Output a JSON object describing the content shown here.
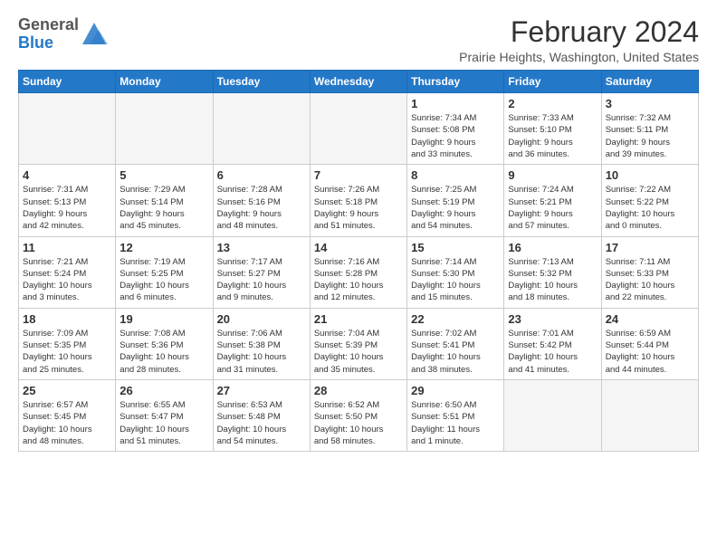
{
  "logo": {
    "general": "General",
    "blue": "Blue"
  },
  "header": {
    "month": "February 2024",
    "location": "Prairie Heights, Washington, United States"
  },
  "weekdays": [
    "Sunday",
    "Monday",
    "Tuesday",
    "Wednesday",
    "Thursday",
    "Friday",
    "Saturday"
  ],
  "weeks": [
    [
      {
        "day": "",
        "info": ""
      },
      {
        "day": "",
        "info": ""
      },
      {
        "day": "",
        "info": ""
      },
      {
        "day": "",
        "info": ""
      },
      {
        "day": "1",
        "info": "Sunrise: 7:34 AM\nSunset: 5:08 PM\nDaylight: 9 hours\nand 33 minutes."
      },
      {
        "day": "2",
        "info": "Sunrise: 7:33 AM\nSunset: 5:10 PM\nDaylight: 9 hours\nand 36 minutes."
      },
      {
        "day": "3",
        "info": "Sunrise: 7:32 AM\nSunset: 5:11 PM\nDaylight: 9 hours\nand 39 minutes."
      }
    ],
    [
      {
        "day": "4",
        "info": "Sunrise: 7:31 AM\nSunset: 5:13 PM\nDaylight: 9 hours\nand 42 minutes."
      },
      {
        "day": "5",
        "info": "Sunrise: 7:29 AM\nSunset: 5:14 PM\nDaylight: 9 hours\nand 45 minutes."
      },
      {
        "day": "6",
        "info": "Sunrise: 7:28 AM\nSunset: 5:16 PM\nDaylight: 9 hours\nand 48 minutes."
      },
      {
        "day": "7",
        "info": "Sunrise: 7:26 AM\nSunset: 5:18 PM\nDaylight: 9 hours\nand 51 minutes."
      },
      {
        "day": "8",
        "info": "Sunrise: 7:25 AM\nSunset: 5:19 PM\nDaylight: 9 hours\nand 54 minutes."
      },
      {
        "day": "9",
        "info": "Sunrise: 7:24 AM\nSunset: 5:21 PM\nDaylight: 9 hours\nand 57 minutes."
      },
      {
        "day": "10",
        "info": "Sunrise: 7:22 AM\nSunset: 5:22 PM\nDaylight: 10 hours\nand 0 minutes."
      }
    ],
    [
      {
        "day": "11",
        "info": "Sunrise: 7:21 AM\nSunset: 5:24 PM\nDaylight: 10 hours\nand 3 minutes."
      },
      {
        "day": "12",
        "info": "Sunrise: 7:19 AM\nSunset: 5:25 PM\nDaylight: 10 hours\nand 6 minutes."
      },
      {
        "day": "13",
        "info": "Sunrise: 7:17 AM\nSunset: 5:27 PM\nDaylight: 10 hours\nand 9 minutes."
      },
      {
        "day": "14",
        "info": "Sunrise: 7:16 AM\nSunset: 5:28 PM\nDaylight: 10 hours\nand 12 minutes."
      },
      {
        "day": "15",
        "info": "Sunrise: 7:14 AM\nSunset: 5:30 PM\nDaylight: 10 hours\nand 15 minutes."
      },
      {
        "day": "16",
        "info": "Sunrise: 7:13 AM\nSunset: 5:32 PM\nDaylight: 10 hours\nand 18 minutes."
      },
      {
        "day": "17",
        "info": "Sunrise: 7:11 AM\nSunset: 5:33 PM\nDaylight: 10 hours\nand 22 minutes."
      }
    ],
    [
      {
        "day": "18",
        "info": "Sunrise: 7:09 AM\nSunset: 5:35 PM\nDaylight: 10 hours\nand 25 minutes."
      },
      {
        "day": "19",
        "info": "Sunrise: 7:08 AM\nSunset: 5:36 PM\nDaylight: 10 hours\nand 28 minutes."
      },
      {
        "day": "20",
        "info": "Sunrise: 7:06 AM\nSunset: 5:38 PM\nDaylight: 10 hours\nand 31 minutes."
      },
      {
        "day": "21",
        "info": "Sunrise: 7:04 AM\nSunset: 5:39 PM\nDaylight: 10 hours\nand 35 minutes."
      },
      {
        "day": "22",
        "info": "Sunrise: 7:02 AM\nSunset: 5:41 PM\nDaylight: 10 hours\nand 38 minutes."
      },
      {
        "day": "23",
        "info": "Sunrise: 7:01 AM\nSunset: 5:42 PM\nDaylight: 10 hours\nand 41 minutes."
      },
      {
        "day": "24",
        "info": "Sunrise: 6:59 AM\nSunset: 5:44 PM\nDaylight: 10 hours\nand 44 minutes."
      }
    ],
    [
      {
        "day": "25",
        "info": "Sunrise: 6:57 AM\nSunset: 5:45 PM\nDaylight: 10 hours\nand 48 minutes."
      },
      {
        "day": "26",
        "info": "Sunrise: 6:55 AM\nSunset: 5:47 PM\nDaylight: 10 hours\nand 51 minutes."
      },
      {
        "day": "27",
        "info": "Sunrise: 6:53 AM\nSunset: 5:48 PM\nDaylight: 10 hours\nand 54 minutes."
      },
      {
        "day": "28",
        "info": "Sunrise: 6:52 AM\nSunset: 5:50 PM\nDaylight: 10 hours\nand 58 minutes."
      },
      {
        "day": "29",
        "info": "Sunrise: 6:50 AM\nSunset: 5:51 PM\nDaylight: 11 hours\nand 1 minute."
      },
      {
        "day": "",
        "info": ""
      },
      {
        "day": "",
        "info": ""
      }
    ]
  ]
}
